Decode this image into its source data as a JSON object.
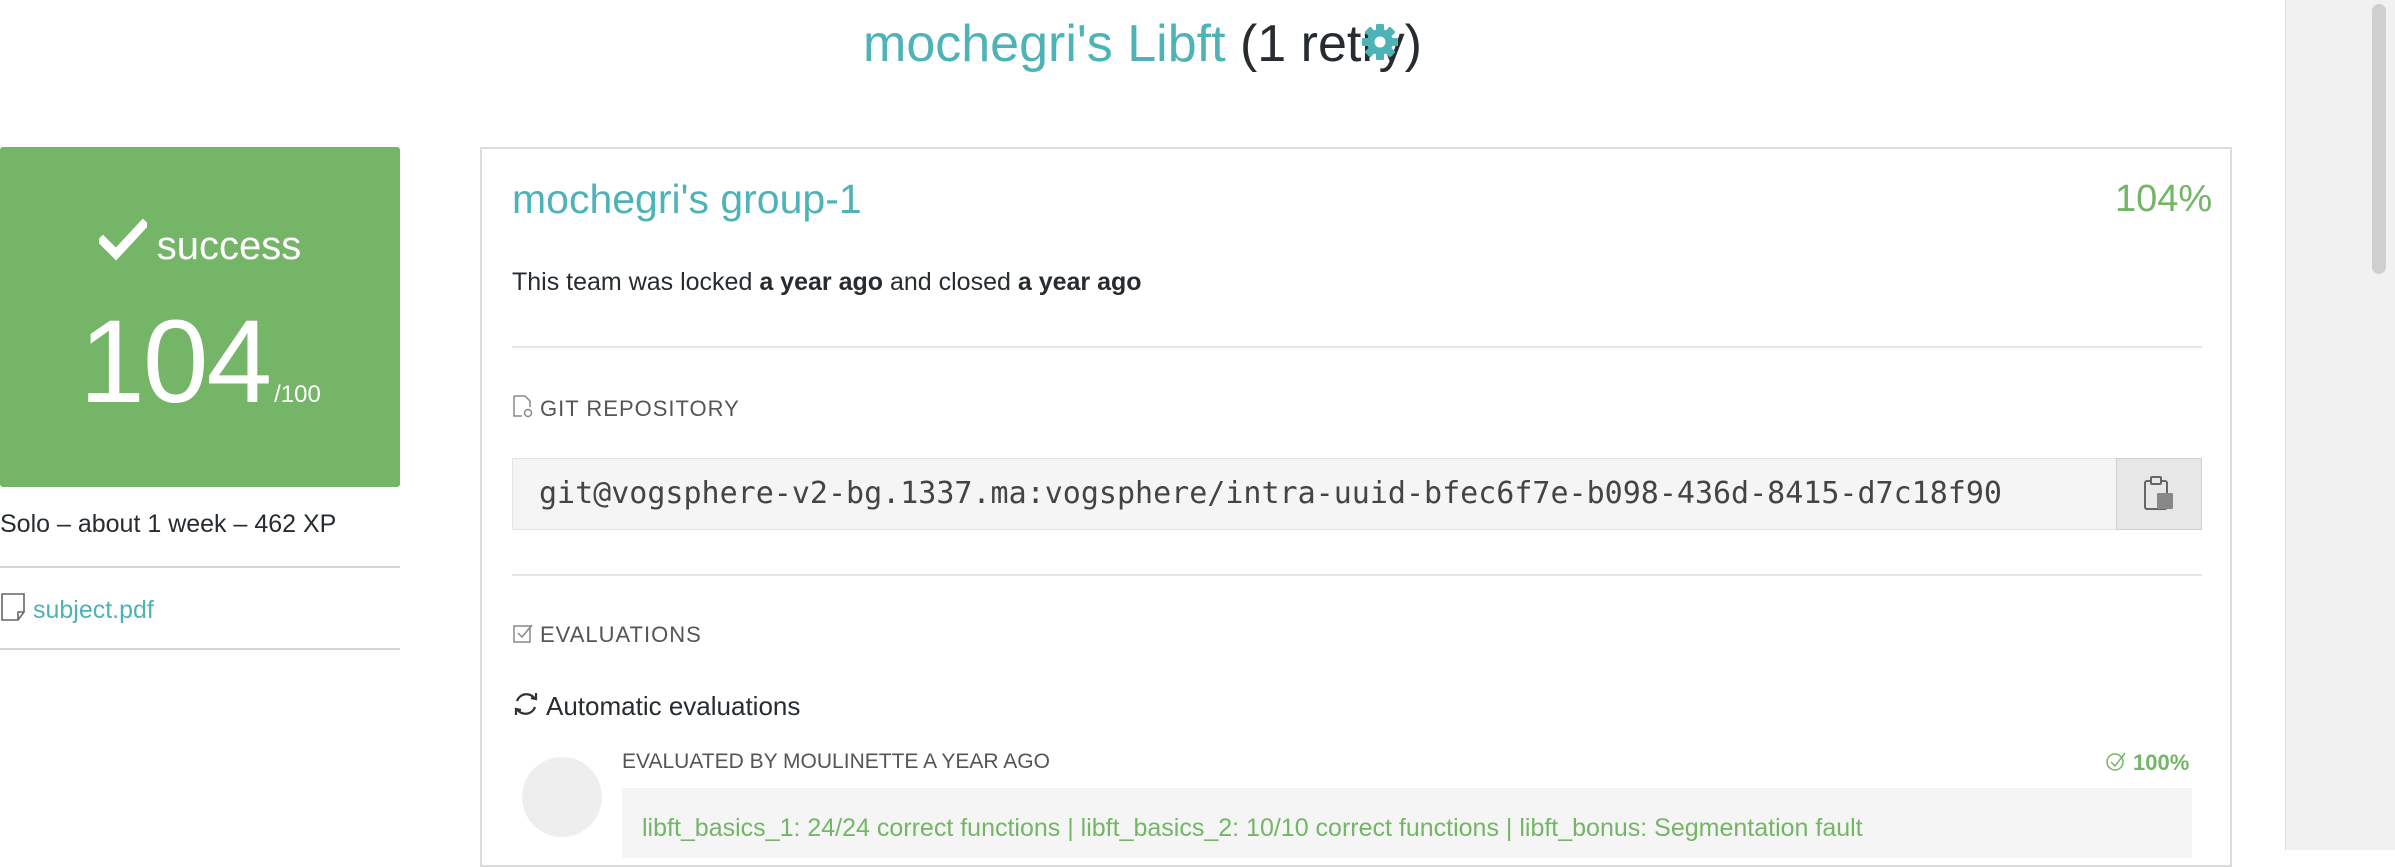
{
  "header": {
    "title_link": "mochegri's Libft",
    "title_retry": "(1 retry)",
    "settings_icon": "gear-icon"
  },
  "score_card": {
    "status": "success",
    "score": "104",
    "score_max": "/100",
    "icon": "checkmark-icon",
    "color": "#74b567"
  },
  "project_info": "Solo – about 1 week – 462 XP",
  "subject": {
    "label": "subject.pdf",
    "icon": "document-icon"
  },
  "team": {
    "name": "mochegri's group-1",
    "percent": "104%",
    "lock_pre": "This team was locked ",
    "lock_time": "a year ago",
    "lock_mid": " and closed ",
    "close_time": "a year ago"
  },
  "git": {
    "heading": "GIT REPOSITORY",
    "url": "git@vogsphere-v2-bg.1337.ma:vogsphere/intra-uuid-bfec6f7e-b098-436d-8415-d7c18f90",
    "copy_icon": "clipboard-icon"
  },
  "evaluations": {
    "heading": "EVALUATIONS",
    "automatic_label": "Automatic evaluations",
    "items": [
      {
        "evaluated_by": "EVALUATED BY MOULINETTE A YEAR AGO",
        "score": "100%",
        "comment": "libft_basics_1: 24/24 correct functions | libft_basics_2: 10/10 correct functions | libft_bonus: Segmentation fault"
      }
    ]
  },
  "colors": {
    "accent": "#4db3b7",
    "success": "#74b567",
    "text": "#262c30"
  }
}
